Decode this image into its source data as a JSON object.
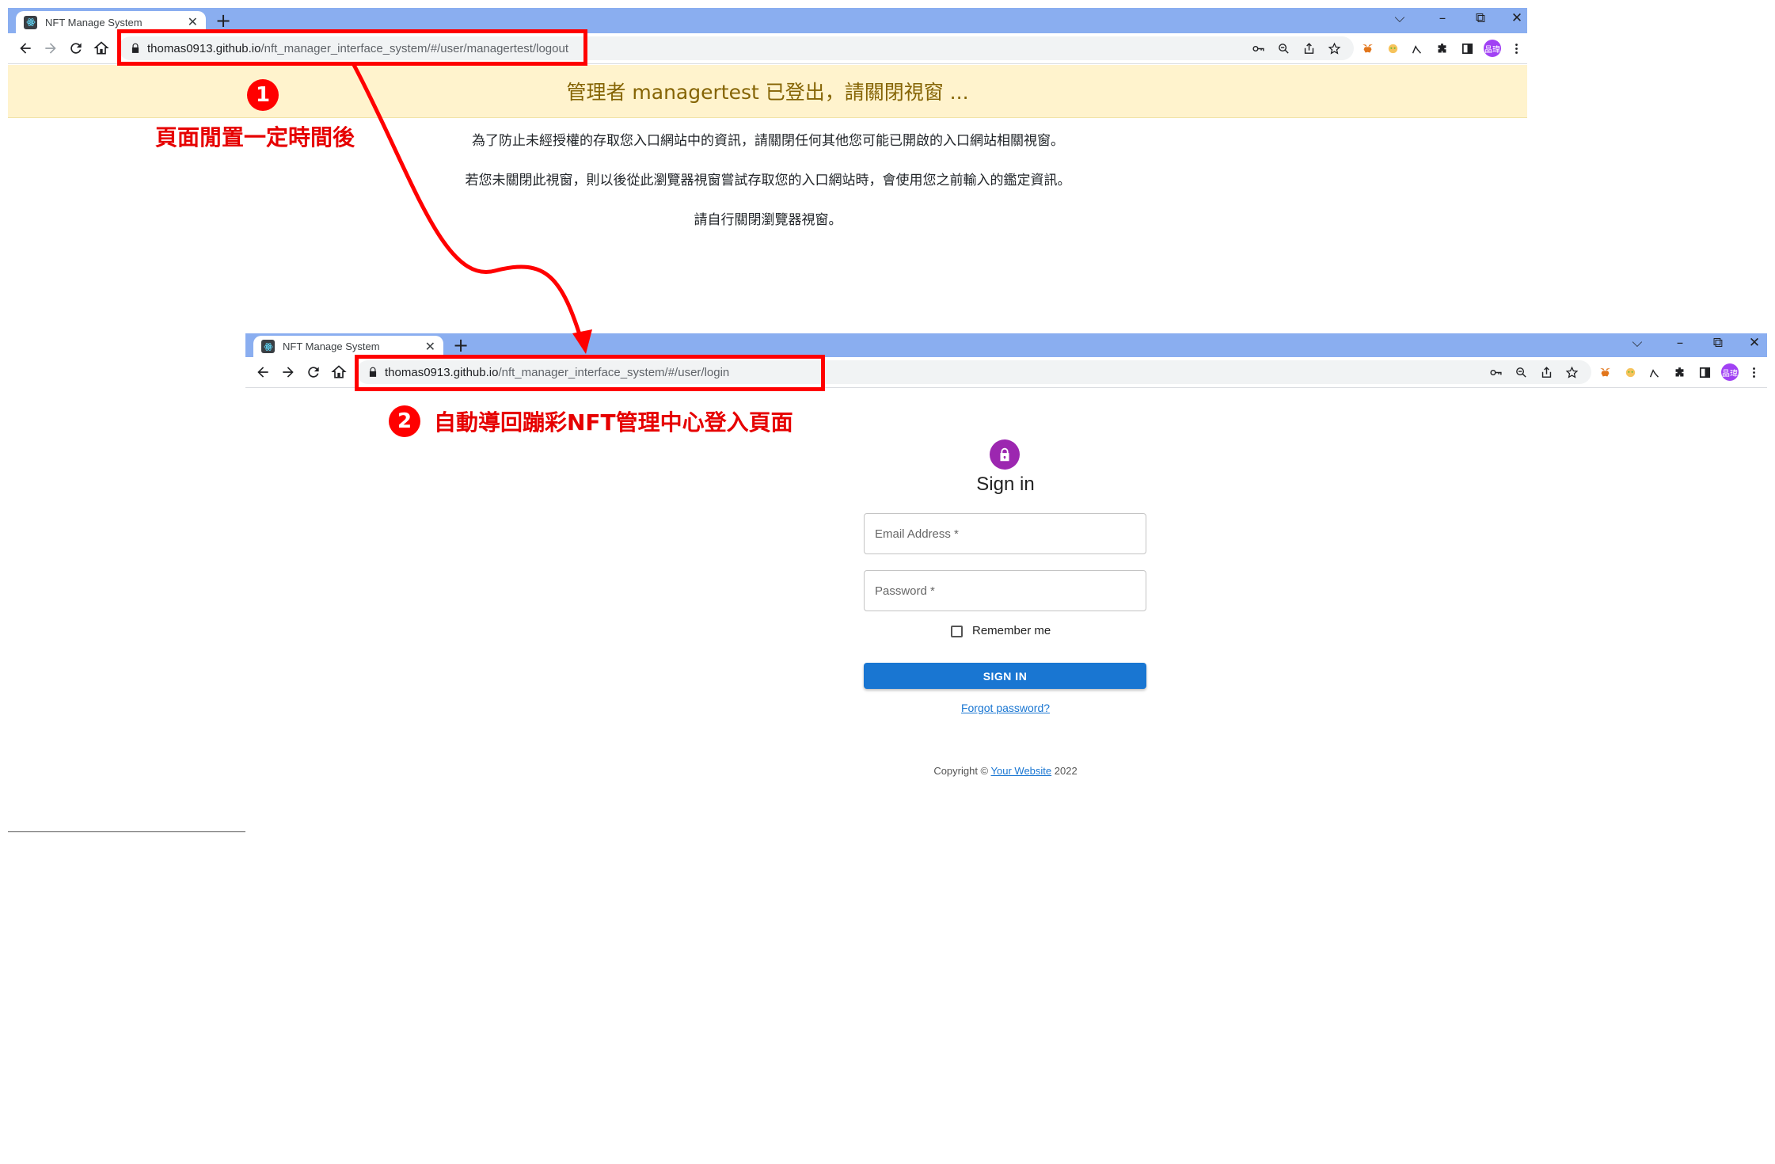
{
  "window1": {
    "tab_title": "NFT Manage System",
    "tab_close": "✕",
    "new_tab": "+",
    "url_domain": "thomas0913.github.io",
    "url_path": "/nft_manager_interface_system/#/user/managertest/logout",
    "banner_text": "管理者 managertest 已登出，請關閉視窗 ...",
    "notice_lines": [
      "為了防止未經授權的存取您入口網站中的資訊，請關閉任何其他您可能已開啟的入口網站相關視窗。",
      "若您未關閉此視窗，則以後從此瀏覽器視窗嘗試存取您的入口網站時，會使用您之前輸入的鑑定資訊。",
      "請自行關閉瀏覽器視窗。"
    ]
  },
  "window2": {
    "tab_title": "NFT Manage System",
    "tab_close": "✕",
    "new_tab": "+",
    "url_domain": "thomas0913.github.io",
    "url_path": "/nft_manager_interface_system/#/user/login"
  },
  "window_controls": {
    "dropdown": "⌵",
    "minimize": "–",
    "restore": "⧉",
    "close": "✕"
  },
  "avatar_text": "晶瑋",
  "annotations": {
    "step1_number": "1",
    "step1_text": "頁面閒置一定時間後",
    "step2_number": "2",
    "step2_text": "自動導回蹦彩NFT管理中心登入頁面"
  },
  "signin": {
    "title": "Sign in",
    "email_placeholder": "Email Address *",
    "password_placeholder": "Password *",
    "remember_label": "Remember me",
    "button_label": "SIGN IN",
    "forgot_link": "Forgot password?",
    "copyright_prefix": "Copyright © ",
    "copyright_link": "Your Website",
    "copyright_suffix": " 2022"
  },
  "icons": [
    "back-icon",
    "forward-icon",
    "reload-icon",
    "home-icon",
    "lock-icon",
    "key-icon",
    "zoom-icon",
    "share-icon",
    "star-icon",
    "metamask-icon",
    "extension-icon",
    "puzzle-icon",
    "sidepanel-icon",
    "menu-icon",
    "react-icon",
    "padlock-icon"
  ],
  "colors": {
    "annotation_red": "#e60000",
    "tabbar_blue": "#8aaef0",
    "banner_bg": "#fff3cd",
    "banner_text": "#856404",
    "signin_button": "#1976d2",
    "avatar_lock": "#9c27b0"
  }
}
